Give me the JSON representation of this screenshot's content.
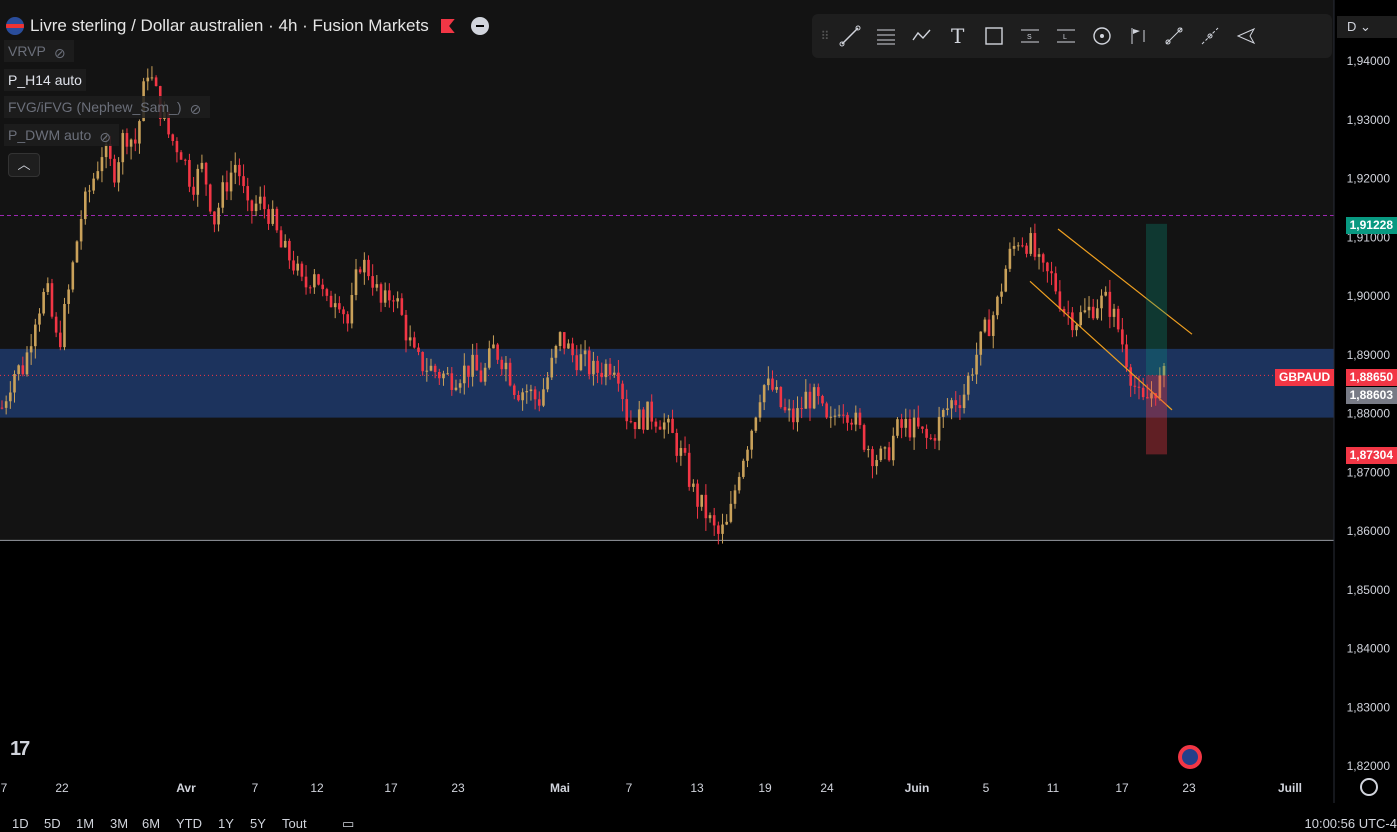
{
  "header": {
    "title": "Livre sterling / Dollar australien · 4h · Fusion Markets",
    "indicators": [
      {
        "label": "VRVP",
        "hidden": true
      },
      {
        "label": "P_H14 auto",
        "hidden": false
      },
      {
        "label": "FVG/iFVG (Nephew_Sam_)",
        "hidden": true
      },
      {
        "label": "P_DWM auto",
        "hidden": true
      }
    ],
    "currency_selector": "D"
  },
  "toolbar_icons": [
    "trendline-icon",
    "fib-icon",
    "path-icon",
    "text-icon",
    "rectangle-icon",
    "long-position-icon",
    "short-position-icon",
    "anchored-vwap-icon",
    "flag-marker-icon",
    "measure-icon",
    "pencil-icon",
    "brush-icon"
  ],
  "colors": {
    "bull": "#c9a15a",
    "bear": "#f23645",
    "zone": "#1f3a6b",
    "channel": "#f0a020",
    "tp": "#089981",
    "sl": "#f23645",
    "level_line": "#9c27b0"
  },
  "price_labels": {
    "tp": "1,91228",
    "last": "1,88650",
    "prev": "1,88603",
    "sl": "1,87304",
    "symbol": "GBPAUD"
  },
  "timeframes": [
    "1D",
    "5D",
    "1M",
    "3M",
    "6M",
    "YTD",
    "1Y",
    "5Y",
    "Tout"
  ],
  "clock": "10:00:56 UTC-4",
  "chart_data": {
    "type": "candlestick",
    "title": "Livre sterling / Dollar australien · 4h · Fusion Markets",
    "y_axis": {
      "range": [
        1.8195,
        1.9445
      ],
      "ticks": [
        "1,94000",
        "1,93000",
        "1,92000",
        "1,91000",
        "1,90000",
        "1,89000",
        "1,88000",
        "1,87000",
        "1,86000",
        "1,85000",
        "1,84000",
        "1,83000",
        "1,82000"
      ],
      "tick_values": [
        1.94,
        1.93,
        1.92,
        1.91,
        1.9,
        1.89,
        1.88,
        1.87,
        1.86,
        1.85,
        1.84,
        1.83,
        1.82
      ]
    },
    "x_axis": {
      "tick_labels": [
        "7",
        "22",
        "Avr",
        "7",
        "12",
        "17",
        "23",
        "Mai",
        "7",
        "13",
        "19",
        "24",
        "Juin",
        "5",
        "11",
        "17",
        "23",
        "Juill"
      ]
    },
    "price_path": [
      1.881,
      1.887,
      1.888,
      1.897,
      1.901,
      1.891,
      1.901,
      1.913,
      1.919,
      1.925,
      1.921,
      1.928,
      1.926,
      1.939,
      1.933,
      1.927,
      1.925,
      1.919,
      1.922,
      1.913,
      1.919,
      1.923,
      1.914,
      1.916,
      1.914,
      1.908,
      1.906,
      1.901,
      1.905,
      1.898,
      1.901,
      1.895,
      1.906,
      1.904,
      1.898,
      1.901,
      1.895,
      1.889,
      1.888,
      1.887,
      1.886,
      1.887,
      1.888,
      1.886,
      1.891,
      1.889,
      1.884,
      1.884,
      1.882,
      1.887,
      1.893,
      1.89,
      1.889,
      1.887,
      1.888,
      1.889,
      1.879,
      1.879,
      1.88,
      1.879,
      1.876,
      1.872,
      1.866,
      1.863,
      1.859,
      1.861,
      1.871,
      1.877,
      1.885,
      1.884,
      1.88,
      1.879,
      1.883,
      1.882,
      1.877,
      1.882,
      1.88,
      1.876,
      1.873,
      1.872,
      1.877,
      1.878,
      1.877,
      1.875,
      1.879,
      1.882,
      1.883,
      1.889,
      1.894,
      1.898,
      1.906,
      1.91,
      1.909,
      1.904,
      1.903,
      1.898,
      1.896,
      1.897,
      1.899,
      1.899,
      1.894,
      1.887,
      1.881,
      1.884,
      1.886
    ],
    "resistance_level": 1.9137,
    "support_level": 1.8584,
    "zone": {
      "low": 1.8793,
      "high": 1.891
    },
    "channel": {
      "upper": [
        [
          1.9114,
          1.8935
        ]
      ],
      "lower": [
        [
          1.9025,
          1.883
        ]
      ]
    },
    "position": {
      "entry": 1.8865,
      "target": 1.91228,
      "stop": 1.87304
    },
    "last_price": 1.8865,
    "prev_close": 1.88603
  }
}
